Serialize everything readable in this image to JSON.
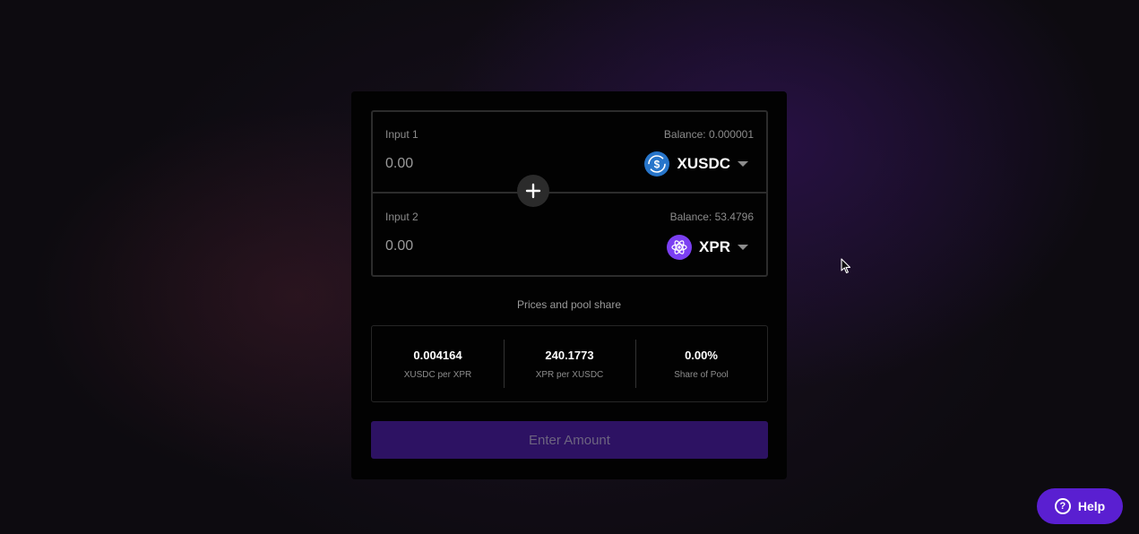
{
  "liquidity": {
    "input1": {
      "label": "Input 1",
      "balance": "Balance: 0.000001",
      "placeholder": "0.00",
      "token": {
        "symbol": "XUSDC",
        "icon": "usdc-token-icon",
        "color": "#2775ca"
      }
    },
    "input2": {
      "label": "Input 2",
      "balance": "Balance: 53.4796",
      "placeholder": "0.00",
      "token": {
        "symbol": "XPR",
        "icon": "xpr-token-icon",
        "color": "#7b3ff2"
      }
    },
    "plus_icon": "plus-icon"
  },
  "prices": {
    "title": "Prices and pool share",
    "items": [
      {
        "value": "0.004164",
        "label": "XUSDC per XPR"
      },
      {
        "value": "240.1773",
        "label": "XPR per XUSDC"
      },
      {
        "value": "0.00%",
        "label": "Share of Pool"
      }
    ]
  },
  "submit": {
    "label": "Enter Amount",
    "color": "#2d1263"
  },
  "help": {
    "label": "Help",
    "icon": "question-circle-icon",
    "color": "#5a1fd1"
  }
}
